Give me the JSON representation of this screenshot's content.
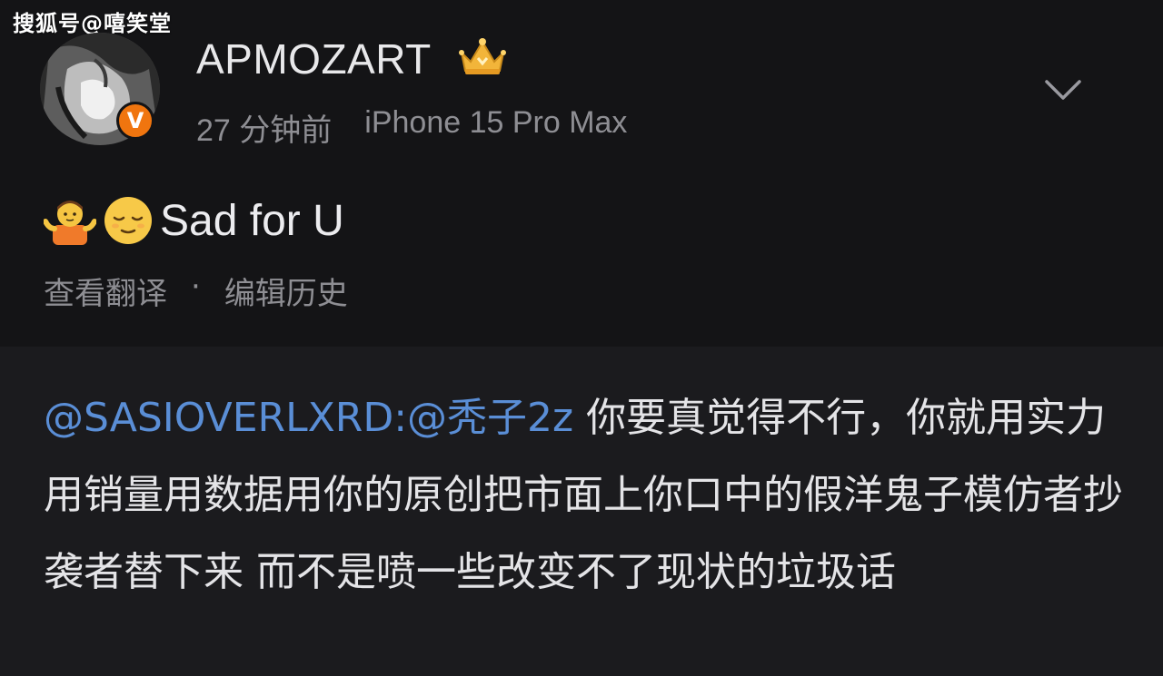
{
  "watermark": "搜狐号@嘻笑堂",
  "post": {
    "username": "APMOZART",
    "badge_letter": "V",
    "time_ago": "27 分钟前",
    "device": "iPhone 15 Pro Max",
    "text": "Sad for U",
    "emojis": [
      "person-shrugging-emoji",
      "relieved-face-emoji"
    ],
    "actions": {
      "translate": "查看翻译",
      "separator": "·",
      "edit_history": "编辑历史"
    }
  },
  "reply": {
    "mention_1": "@SASIOVERLXRD",
    "colon": ":",
    "mention_2": "@秃子2z",
    "body": " 你要真觉得不行，你就用实力用销量用数据用你的原创把市面上你口中的假洋鬼子模仿者抄袭者替下来 而不是喷一些改变不了现状的垃圾话"
  },
  "colors": {
    "background_top": "#141416",
    "background_bottom": "#1b1b1e",
    "mention_blue": "#5a8ed6",
    "muted_gray": "#8e8e93",
    "verified_orange": "#f0750f",
    "crown_gold": "#f2b53a"
  }
}
